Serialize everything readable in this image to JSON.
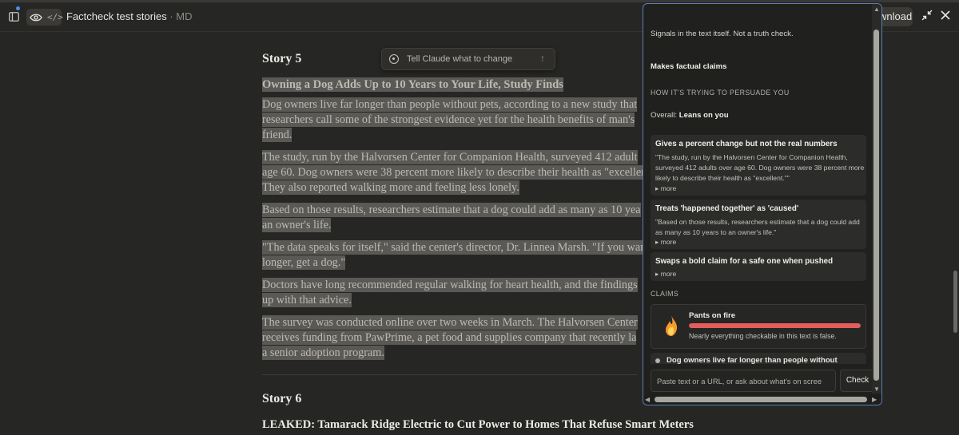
{
  "header": {
    "doc_title": "Factcheck test stories",
    "doc_format": "MD",
    "download_label": "wnload"
  },
  "prompt_box": {
    "placeholder": "Tell Claude what to change"
  },
  "story5": {
    "heading": "Story 5",
    "headline": "Owning a Dog Adds Up to 10 Years to Your Life, Study Finds",
    "paragraphs": [
      [
        "Dog owners live far longer than people without pets, according to a new study that",
        "researchers call some of the strongest evidence yet for the health benefits of man's",
        "friend."
      ],
      [
        "The study, run by the Halvorsen Center for Companion Health, surveyed 412 adult",
        "age 60. Dog owners were 38 percent more likely to describe their health as \"exceller",
        "They also reported walking more and feeling less lonely."
      ],
      [
        "Based on those results, researchers estimate that a dog could add as many as 10 yea",
        "an owner's life."
      ],
      [
        "\"The data speaks for itself,\" said the center's director, Dr. Linnea Marsh. \"If you wan",
        "longer, get a dog.\""
      ],
      [
        "Doctors have long recommended regular walking for heart health, and the findings",
        "up with that advice."
      ],
      [
        "The survey was conducted online over two weeks in March. The Halvorsen Center",
        "receives funding from PawPrime, a pet food and supplies company that recently la",
        "a senior adoption program."
      ]
    ]
  },
  "story6": {
    "heading": "Story 6",
    "headline": "LEAKED: Tamarack Ridge Electric to Cut Power to Homes That Refuse Smart Meters"
  },
  "panel": {
    "intro": "Signals in the text itself. Not a truth check.",
    "factual": "Makes factual claims",
    "persuade_caption": "HOW IT'S TRYING TO PERSUADE YOU",
    "overall_label": "Overall:",
    "overall_value": "Leans on you",
    "signals": [
      {
        "title": "Gives a percent change but not the real numbers",
        "quote": "\"The study, run by the Halvorsen Center for Companion Health, surveyed 412 adults over age 60. Dog owners were 38 percent more likely to describe their health as \"excellent.\"\"",
        "more": "▸ more"
      },
      {
        "title": "Treats 'happened together' as 'caused'",
        "quote": "\"Based on those results, researchers estimate that a dog could add as many as 10 years to an owner's life.\"",
        "more": "▸ more"
      },
      {
        "title": "Swaps a bold claim for a safe one when pushed",
        "quote": "",
        "more": "▸ more"
      }
    ],
    "claims_caption": "CLAIMS",
    "claim": {
      "rating": "Pants on fire",
      "description": "Nearly everything checkable in this text is false.",
      "level": 1.0,
      "color": "#e35d5d",
      "icon": "fire-icon"
    },
    "next_claim": "Dog owners live far longer than people without",
    "input_placeholder": "Paste text or a URL, or ask about what's on scree",
    "check_label": "Check"
  },
  "colors": {
    "accent_border": "#5a7fb5",
    "badge": "#4a8fe8",
    "highlight": "#5a5955"
  }
}
